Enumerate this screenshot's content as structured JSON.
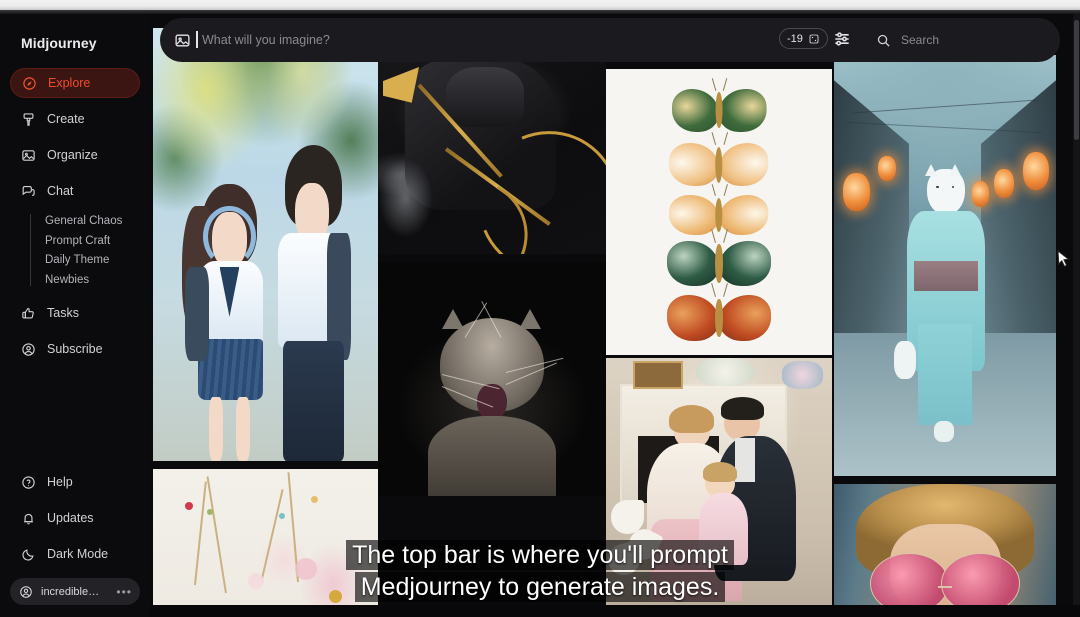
{
  "app": {
    "brand": "Midjourney"
  },
  "sidebar": {
    "items": [
      {
        "label": "Explore",
        "icon": "compass-icon",
        "active": true
      },
      {
        "label": "Create",
        "icon": "brush-icon",
        "active": false
      },
      {
        "label": "Organize",
        "icon": "image-icon",
        "active": false
      },
      {
        "label": "Chat",
        "icon": "chat-icon",
        "active": false
      }
    ],
    "chat_children": [
      {
        "label": "General Chaos"
      },
      {
        "label": "Prompt Craft"
      },
      {
        "label": "Daily Theme"
      },
      {
        "label": "Newbies"
      }
    ],
    "items_after": [
      {
        "label": "Tasks",
        "icon": "thumbs-up-icon"
      },
      {
        "label": "Subscribe",
        "icon": "user-circle-icon"
      }
    ],
    "bottom_items": [
      {
        "label": "Help",
        "icon": "question-circle-icon"
      },
      {
        "label": "Updates",
        "icon": "bell-icon"
      },
      {
        "label": "Dark Mode",
        "icon": "moon-icon"
      }
    ],
    "user": {
      "name": "incredible…",
      "icon": "user-circle-icon",
      "menu": "•••"
    }
  },
  "topbar": {
    "prompt": {
      "icon": "image-icon",
      "value": "",
      "placeholder": "What will you imagine?"
    },
    "credits": {
      "value": "-19",
      "icon": "grid-icon"
    },
    "settings_icon": "sliders-icon",
    "search": {
      "icon": "search-icon",
      "value": "",
      "placeholder": "Search"
    }
  },
  "gallery": {
    "tiles": [
      {
        "name": "anime-students",
        "alt": "Two anime students under sunlit green trees"
      },
      {
        "name": "floral-emboss",
        "alt": "Embossed pastel floral pattern"
      },
      {
        "name": "dark-samurai",
        "alt": "Dark armored warrior with gold ribbons"
      },
      {
        "name": "yawning-cat",
        "alt": "Tabby cat yawning on black background"
      },
      {
        "name": "butterfly-plate",
        "alt": "Five painted butterflies on white"
      },
      {
        "name": "vintage-family",
        "alt": "Vintage painted family portrait by a fireplace"
      },
      {
        "name": "kitsune-street",
        "alt": "Fox-masked figure in teal kimono on misty street"
      },
      {
        "name": "pink-sunglasses",
        "alt": "Blonde person wearing round pink sunglasses"
      }
    ]
  },
  "caption": {
    "line1": "The top bar is where you'll prompt",
    "line2": "Medjourney to generate images."
  },
  "colors": {
    "accent": "#f0522f",
    "accent_bg": "#3a1512",
    "sidebar_bg": "#0b0b0d",
    "surface": "#1b1b1f",
    "app_bg": "#0a0a0c"
  }
}
